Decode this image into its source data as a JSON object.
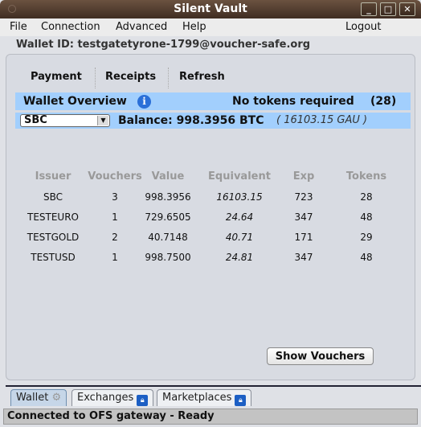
{
  "window": {
    "title": "Silent Vault",
    "minimize": "_",
    "maximize": "□",
    "close": "✕"
  },
  "menu": {
    "file": "File",
    "connection": "Connection",
    "advanced": "Advanced",
    "help": "Help",
    "logout": "Logout"
  },
  "wallet_id": "Wallet ID: testgatetyrone-1799@voucher-safe.org",
  "toolbar": {
    "payment": "Payment",
    "receipts": "Receipts",
    "refresh": "Refresh"
  },
  "overview": {
    "title": "Wallet Overview",
    "info_icon": "i",
    "tokens_status": "No tokens required",
    "count": "(28)"
  },
  "balance": {
    "selected_issuer": "SBC",
    "label": "Balance: 998.3956 BTC",
    "equivalent": "( 16103.15 GAU )"
  },
  "table": {
    "headers": [
      "Issuer",
      "Vouchers",
      "Value",
      "Equivalent",
      "Exp",
      "Tokens"
    ],
    "rows": [
      [
        "SBC",
        "3",
        "998.3956",
        "16103.15",
        "723",
        "28"
      ],
      [
        "TESTEURO",
        "1",
        "729.6505",
        "24.64",
        "347",
        "48"
      ],
      [
        "TESTGOLD",
        "2",
        "40.7148",
        "40.71",
        "171",
        "29"
      ],
      [
        "TESTUSD",
        "1",
        "998.7500",
        "24.81",
        "347",
        "48"
      ]
    ]
  },
  "show_vouchers": "Show Vouchers",
  "tabs": [
    {
      "label": "Wallet",
      "icon": "network-icon"
    },
    {
      "label": "Exchanges",
      "icon": "lock-icon"
    },
    {
      "label": "Marketplaces",
      "icon": "lock-icon"
    }
  ],
  "status": "Connected to OFS gateway - Ready",
  "colors": {
    "accent_bar": "#a2cffd",
    "titlebar": "#4f3a2c"
  }
}
